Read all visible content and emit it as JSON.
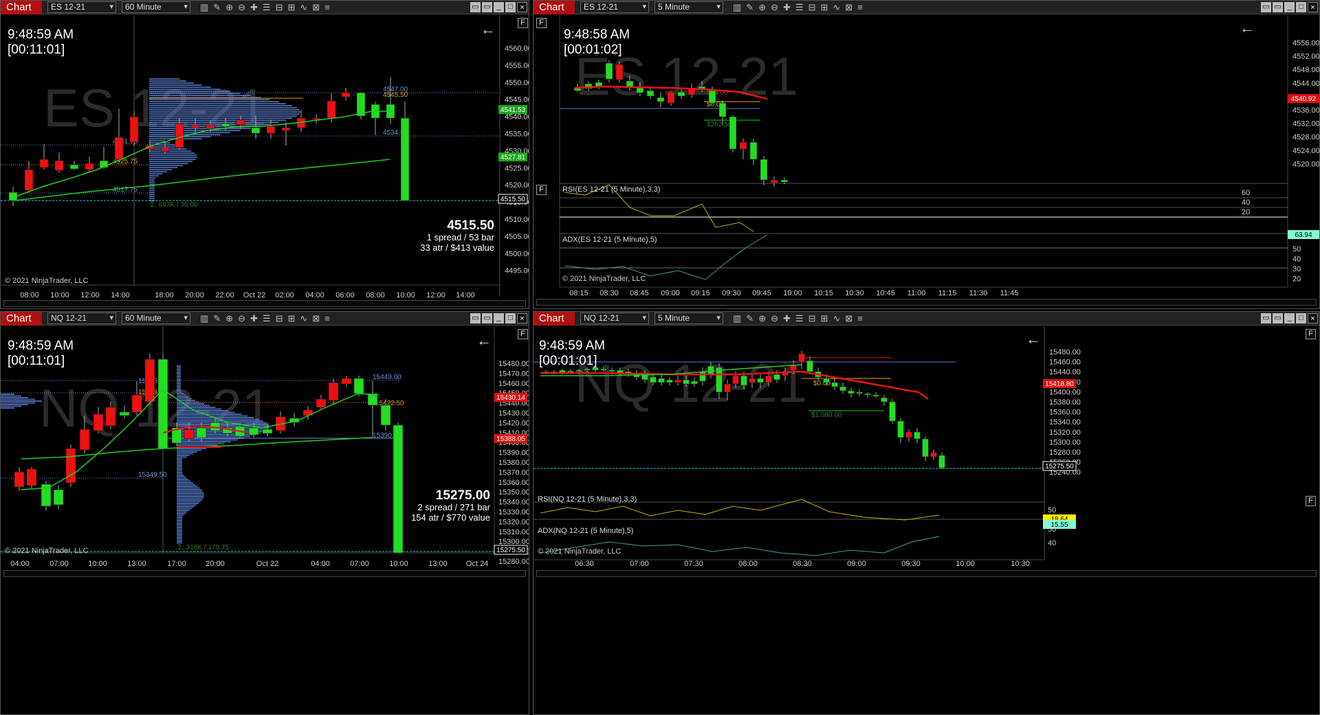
{
  "colors": {
    "up": "#22dd22",
    "down": "#ff1111",
    "profile": "#5b82d6",
    "price_line": "#00e5e5",
    "ema": "#22cc22",
    "ma_red": "#ee1111"
  },
  "common": {
    "tab": "Chart",
    "close": "×",
    "f": "F",
    "arrow": "←",
    "copyright": "© 2021 NinjaTrader, LLC"
  },
  "charts": [
    {
      "instrument": "ES 12-21",
      "interval": "60 Minute",
      "time": "9:48:59 AM",
      "countdown": "[00:11:01]",
      "watermark": "ES 12-21",
      "last": "4515.50",
      "info1": "1 spread / 53 bar",
      "info2": "33 atr / $413 value",
      "yticks": [
        "4560.00",
        "4555.00",
        "4550.00",
        "4545.00",
        "4540.00",
        "4535.00",
        "4530.00",
        "4525.00",
        "4520.00",
        "4515.00",
        "4510.00",
        "4505.00",
        "4500.00",
        "4495.00"
      ],
      "ytags": [
        {
          "v": "4541.53",
          "c": "#1aa81a"
        },
        {
          "v": "4527.81",
          "c": "#1aa81a"
        },
        {
          "v": "4515.50",
          "c": "#000"
        }
      ],
      "xticks": [
        "08:00",
        "10:00",
        "12:00",
        "14:00",
        "18:00",
        "20:00",
        "22:00",
        "Oct 22",
        "02:00",
        "04:00",
        "06:00",
        "08:00",
        "10:00",
        "12:00",
        "14:00"
      ],
      "levels": [
        "4547.00",
        "4545.50",
        "4534.50",
        "4531.75",
        "4525.75",
        "4517.75"
      ],
      "profile_total": "Σ: 697K / 36.00"
    },
    {
      "instrument": "ES 12-21",
      "interval": "5 Minute",
      "time": "9:48:58 AM",
      "countdown": "[00:01:02]",
      "watermark": "ES 12-21",
      "yticks": [
        "4556.00",
        "4552.00",
        "4548.00",
        "4544.00",
        "4540.00",
        "4536.00",
        "4532.00",
        "4528.00",
        "4524.00",
        "4520.00"
      ],
      "ytags": [
        {
          "v": "4540.92",
          "c": "#e01010"
        },
        {
          "v": "63.94",
          "c": "#7fffd4"
        }
      ],
      "xticks": [
        "08:15",
        "08:30",
        "08:45",
        "09:00",
        "09:15",
        "09:30",
        "09:45",
        "10:00",
        "10:15",
        "10:30",
        "10:45",
        "11:00",
        "11:15",
        "11:30",
        "11:45"
      ],
      "rsi": "RSI(ES 12-21 (5 Minute),3,3)",
      "adx": "ADX(ES 12-21 (5 Minute),5)",
      "rsi_ticks": [
        "60",
        "40",
        "20"
      ],
      "adx_ticks": [
        "50",
        "40",
        "30",
        "20"
      ],
      "labels": [
        "$75.00",
        "$0.00",
        "$262.50"
      ]
    },
    {
      "instrument": "NQ 12-21",
      "interval": "60 Minute",
      "time": "9:48:59 AM",
      "countdown": "[00:11:01]",
      "watermark": "NQ 12-21",
      "last": "15275.00",
      "info1": "2 spread / 271 bar",
      "info2": "154 atr / $770 value",
      "yticks": [
        "15480.00",
        "15470.00",
        "15460.00",
        "15450.00",
        "15440.00",
        "15430.00",
        "15420.00",
        "15410.00",
        "15400.00",
        "15390.00",
        "15380.00",
        "15370.00",
        "15360.00",
        "15350.00",
        "15340.00",
        "15330.00",
        "15320.00",
        "15310.00",
        "15300.00",
        "15290.00",
        "15280.00"
      ],
      "ytags": [
        {
          "v": "15430.14",
          "c": "#e01010"
        },
        {
          "v": "15388.05",
          "c": "#e01010"
        },
        {
          "v": "15275.50",
          "c": "#000"
        }
      ],
      "xticks": [
        "04:00",
        "07:00",
        "10:00",
        "13:00",
        "17:00",
        "20:00",
        "Oct 22",
        "04:00",
        "07:00",
        "10:00",
        "13:00",
        "Oct 24"
      ],
      "levels": [
        "15449.00",
        "15445.0",
        "15433.5",
        "15422.50",
        "15390.0",
        "15349.50"
      ],
      "profile_total": "Σ: 318K / 179.75"
    },
    {
      "instrument": "NQ 12-21",
      "interval": "5 Minute",
      "time": "9:48:59 AM",
      "countdown": "[00:01:01]",
      "watermark": "NQ 12-21",
      "yticks": [
        "15480.00",
        "15460.00",
        "15440.00",
        "15420.00",
        "15400.00",
        "15380.00",
        "15360.00",
        "15340.00",
        "15320.00",
        "15300.00",
        "15280.00",
        "15260.00",
        "15240.00"
      ],
      "ytags": [
        {
          "v": "15418.80",
          "c": "#e01010"
        },
        {
          "v": "15275.50",
          "c": "#000"
        },
        {
          "v": "18.64",
          "c": "#ffee00"
        },
        {
          "v": "15.55",
          "c": "#7fffd4"
        }
      ],
      "xticks": [
        "06:30",
        "07:00",
        "07:30",
        "08:00",
        "08:30",
        "09:00",
        "09:30",
        "10:00",
        "10:30"
      ],
      "rsi": "RSI(NQ 12-21 (5 Minute),3,3)",
      "adx": "ADX(NQ 12-21 (5 Minute),5)",
      "rsi_ticks": [
        "50"
      ],
      "adx_ticks": [
        "50",
        "40"
      ],
      "labels": [
        "$0.00",
        "$1,080.00"
      ]
    }
  ]
}
